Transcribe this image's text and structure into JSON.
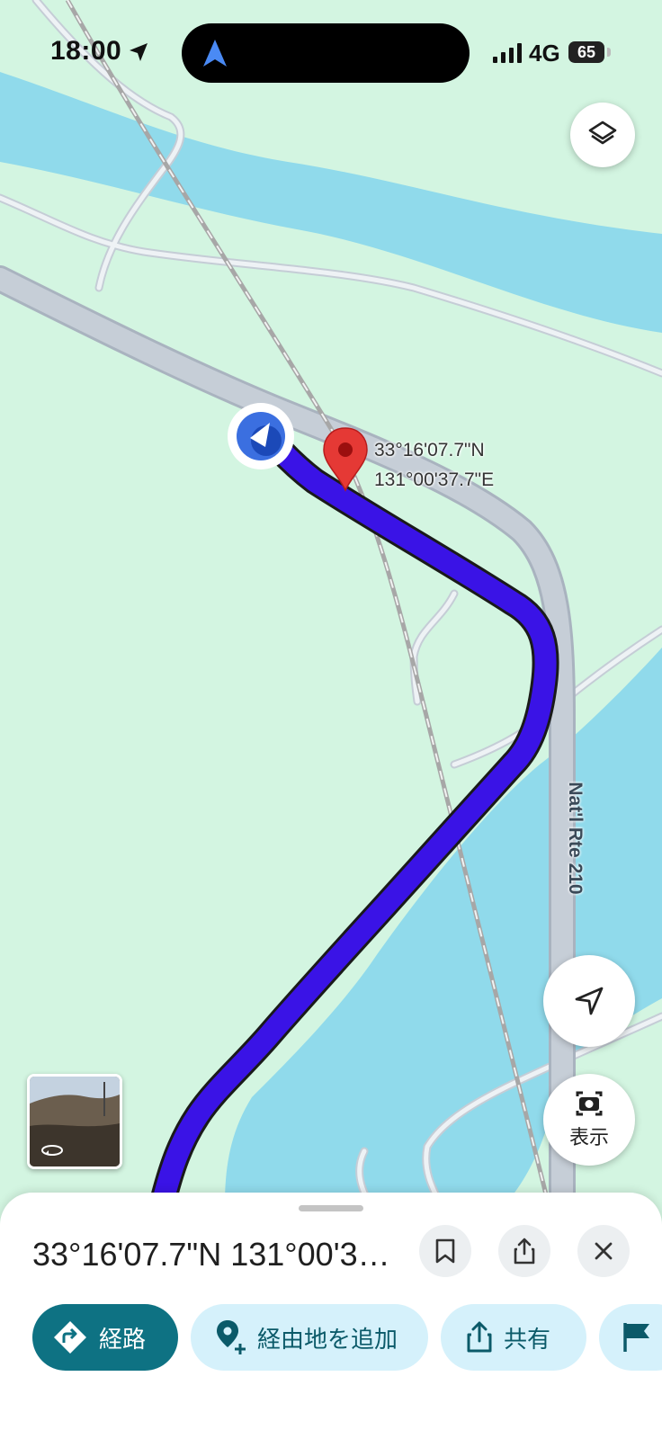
{
  "status_bar": {
    "time": "18:00",
    "network": "4G",
    "battery": "65"
  },
  "map": {
    "dropped_pin_coords": [
      "33°16'07.7\"N",
      "131°00'37.7\"E"
    ],
    "road_label": "Nat'l Rte 210",
    "route_color": "#3a13e6",
    "water_color": "#90daeb",
    "land_color": "#d3f5e1"
  },
  "buttons": {
    "lens_label": "表示"
  },
  "sheet": {
    "title": "33°16'07.7\"N 131°00'37.7\"E",
    "actions": [
      {
        "label": "経路",
        "icon": "directions-icon"
      },
      {
        "label": "経由地を追加",
        "icon": "add-stop-icon"
      },
      {
        "label": "共有",
        "icon": "share-icon"
      },
      {
        "label": "",
        "icon": "flag-icon"
      }
    ]
  }
}
